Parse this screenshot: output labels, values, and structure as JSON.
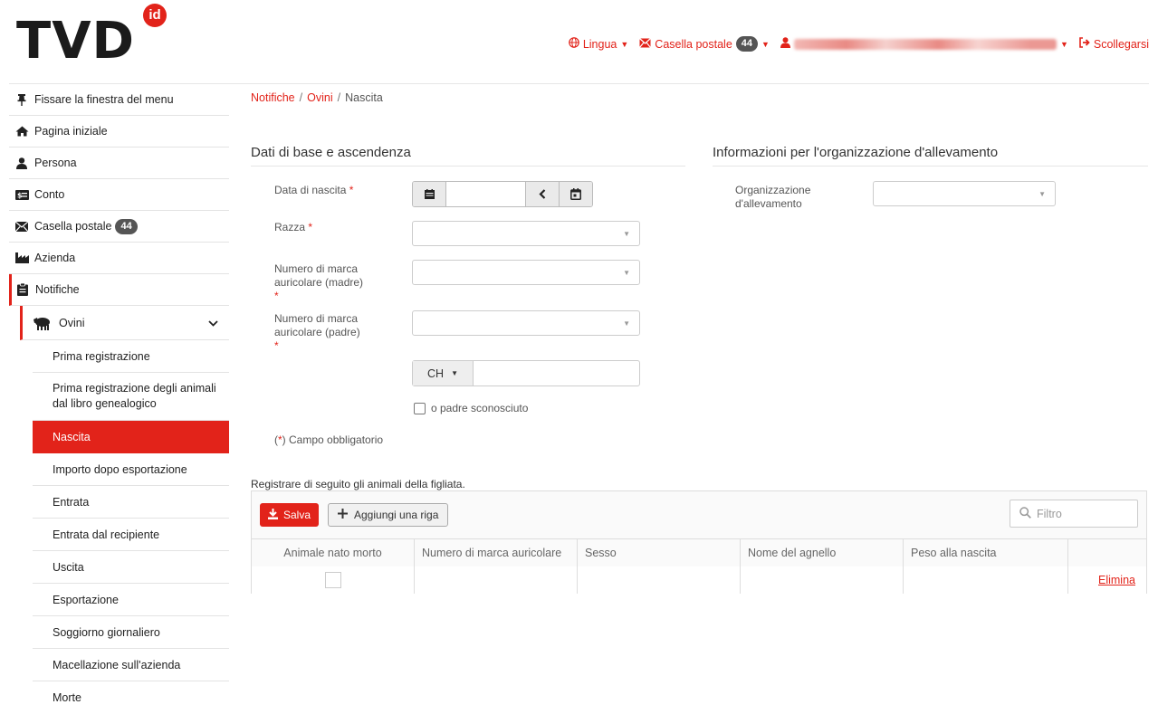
{
  "header": {
    "logo_text": "TVD",
    "logo_badge": "id",
    "language": "Lingua",
    "mailbox": "Casella postale",
    "mailbox_count": "44",
    "logout": "Scollegarsi"
  },
  "sidebar": {
    "pin": "Fissare la finestra del menu",
    "home": "Pagina iniziale",
    "person": "Persona",
    "account": "Conto",
    "mailbox": "Casella postale",
    "mailbox_count": "44",
    "farm": "Azienda",
    "notifications": "Notifiche",
    "sheep": "Ovini",
    "sub": [
      "Prima registrazione",
      "Prima registrazione degli animali dal libro genealogico",
      "Nascita",
      "Importo dopo esportazione",
      "Entrata",
      "Entrata dal recipiente",
      "Uscita",
      "Esportazione",
      "Soggiorno giornaliero",
      "Macellazione sull'azienda",
      "Morte"
    ]
  },
  "breadcrumb": [
    "Notifiche",
    "Ovini",
    "Nascita"
  ],
  "form": {
    "section_left": "Dati di base e ascendenza",
    "section_right": "Informazioni per l'organizzazione d'allevamento",
    "birth_date": "Data di nascita",
    "breed": "Razza",
    "mother_tag": "Numero di marca auricolare (madre)",
    "father_tag": "Numero di marca auricolare (padre)",
    "required_marker": "*",
    "country": "CH",
    "unknown_father": "o padre sconosciuto",
    "required_note_open": "(",
    "required_note_star": "*",
    "required_note_rest": ") Campo obbligatorio",
    "breeding_org": "Organizzazione d'allevamento"
  },
  "grid": {
    "caption": "Registrare di seguito gli animali della figliata.",
    "save": "Salva",
    "add_row": "Aggiungi una riga",
    "filter_placeholder": "Filtro",
    "columns": [
      "Animale nato morto",
      "Numero di marca auricolare",
      "Sesso",
      "Nome del agnello",
      "Peso alla nascita",
      ""
    ],
    "delete": "Elimina"
  },
  "colors": {
    "accent": "#e2231a"
  }
}
